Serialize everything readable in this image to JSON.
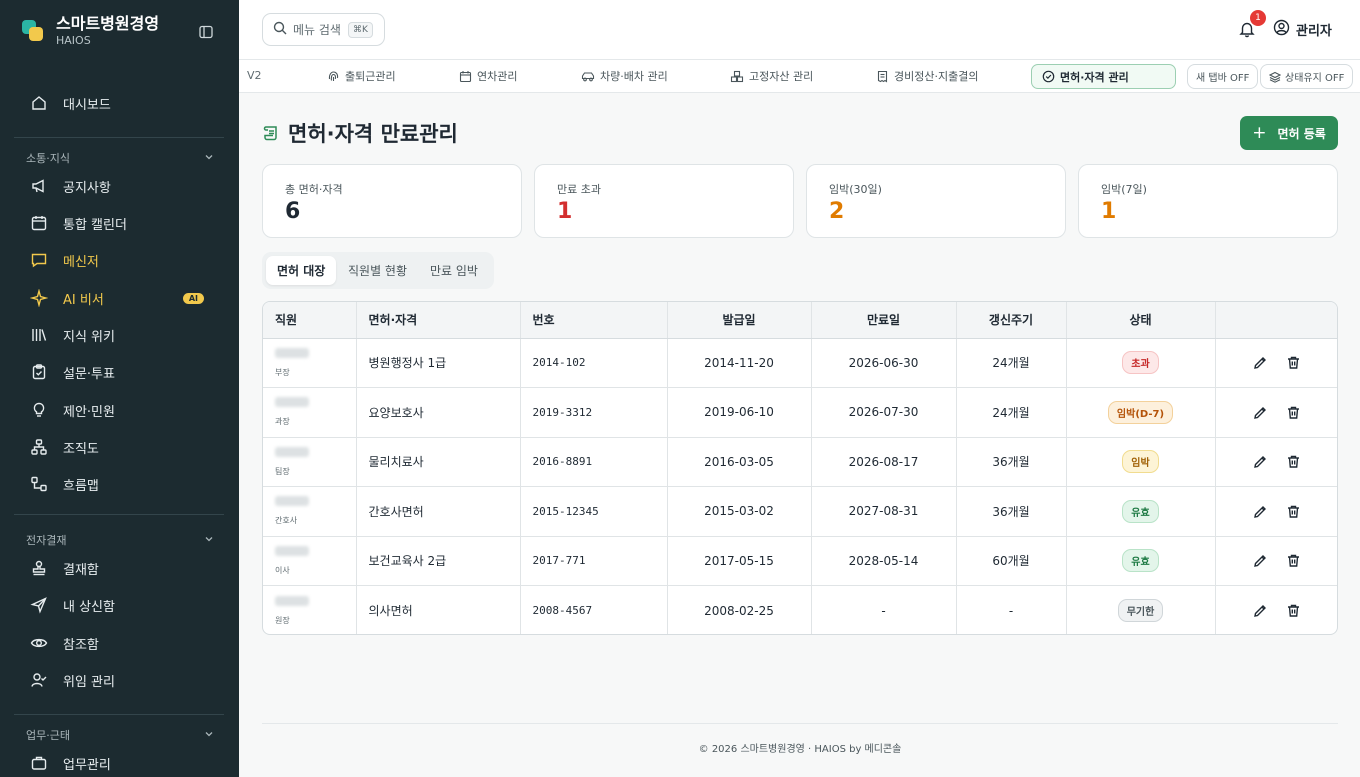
{
  "brand": {
    "name": "스마트병원경영",
    "sub": "HAIOS"
  },
  "sidebar": {
    "top_items": [
      {
        "label": "대시보드",
        "icon": "home-icon"
      }
    ],
    "sections": [
      {
        "title": "소통·지식",
        "items": [
          {
            "label": "공지사항",
            "icon": "megaphone-icon"
          },
          {
            "label": "통합 캘린더",
            "icon": "calendar-icon"
          },
          {
            "label": "메신저",
            "icon": "chat-icon"
          },
          {
            "label": "AI 비서",
            "icon": "sparkle-icon",
            "badge": "AI"
          },
          {
            "label": "지식 위키",
            "icon": "library-icon"
          },
          {
            "label": "설문·투표",
            "icon": "clipboard-icon"
          },
          {
            "label": "제안·민원",
            "icon": "lightbulb-icon"
          },
          {
            "label": "조직도",
            "icon": "org-chart-icon"
          },
          {
            "label": "흐름맵",
            "icon": "flow-icon"
          }
        ]
      },
      {
        "title": "전자결재",
        "items": [
          {
            "label": "결재함",
            "icon": "stamp-icon"
          },
          {
            "label": "내 상신함",
            "icon": "send-icon"
          },
          {
            "label": "참조함",
            "icon": "eye-icon"
          },
          {
            "label": "위임 관리",
            "icon": "user-check-icon"
          }
        ]
      },
      {
        "title": "업무·근태",
        "items": [
          {
            "label": "업무관리",
            "icon": "briefcase-icon"
          }
        ]
      }
    ]
  },
  "topbar": {
    "search_placeholder": "메뉴 검색",
    "shortcut": "⌘K",
    "notification_count": "1",
    "user": "관리자"
  },
  "tabbar": {
    "version": "V2",
    "tabs": [
      {
        "label": "출퇴근관리",
        "icon": "fingerprint-icon"
      },
      {
        "label": "연차관리",
        "icon": "calendar-icon"
      },
      {
        "label": "차량·배차 관리",
        "icon": "car-icon"
      },
      {
        "label": "고정자산 관리",
        "icon": "boxes-icon"
      },
      {
        "label": "경비정산·지출결의",
        "icon": "receipt-icon"
      },
      {
        "label": "면허·자격 관리",
        "icon": "check-circle-icon",
        "active": true
      }
    ],
    "new_tab_toggle": "새 탭바 OFF",
    "keep_state_toggle": "상태유지 OFF"
  },
  "page": {
    "title": "면허·자격 만료관리",
    "add_button": "면허 등록"
  },
  "stats": [
    {
      "label": "총 면허·자격",
      "value": "6",
      "color": "#1f2933"
    },
    {
      "label": "만료 초과",
      "value": "1",
      "color": "#d32f2f"
    },
    {
      "label": "임박(30일)",
      "value": "2",
      "color": "#e07b00"
    },
    {
      "label": "임박(7일)",
      "value": "1",
      "color": "#e07b00"
    }
  ],
  "segments": [
    "면허 대장",
    "직원별 현황",
    "만료 임박"
  ],
  "table": {
    "headers": [
      "직원",
      "면허·자격",
      "번호",
      "발급일",
      "만료일",
      "갱신주기",
      "상태",
      ""
    ],
    "rows": [
      {
        "position": "부장",
        "license": "병원행정사 1급",
        "number": "2014-102",
        "issued": "2014-11-20",
        "expires": "2026-06-30",
        "cycle": "24개월",
        "status": "초과",
        "status_type": "over"
      },
      {
        "position": "과장",
        "license": "요양보호사",
        "number": "2019-3312",
        "issued": "2019-06-10",
        "expires": "2026-07-30",
        "cycle": "24개월",
        "status": "임박(D-7)",
        "status_type": "d7"
      },
      {
        "position": "팀장",
        "license": "물리치료사",
        "number": "2016-8891",
        "issued": "2016-03-05",
        "expires": "2026-08-17",
        "cycle": "36개월",
        "status": "임박",
        "status_type": "imminent"
      },
      {
        "position": "간호사",
        "license": "간호사면허",
        "number": "2015-12345",
        "issued": "2015-03-02",
        "expires": "2027-08-31",
        "cycle": "36개월",
        "status": "유효",
        "status_type": "valid"
      },
      {
        "position": "이사",
        "license": "보건교육사 2급",
        "number": "2017-771",
        "issued": "2017-05-15",
        "expires": "2028-05-14",
        "cycle": "60개월",
        "status": "유효",
        "status_type": "valid"
      },
      {
        "position": "원장",
        "license": "의사면허",
        "number": "2008-4567",
        "issued": "2008-02-25",
        "expires": "-",
        "cycle": "-",
        "status": "무기한",
        "status_type": "perm"
      }
    ]
  },
  "footer": "© 2026 스마트병원경영 · HAIOS by 메디콘솔",
  "colors": {
    "sidebar_bg": "#1c2b30",
    "accent_green": "#2e8b57",
    "highlight_yellow": "#f2c94c"
  }
}
